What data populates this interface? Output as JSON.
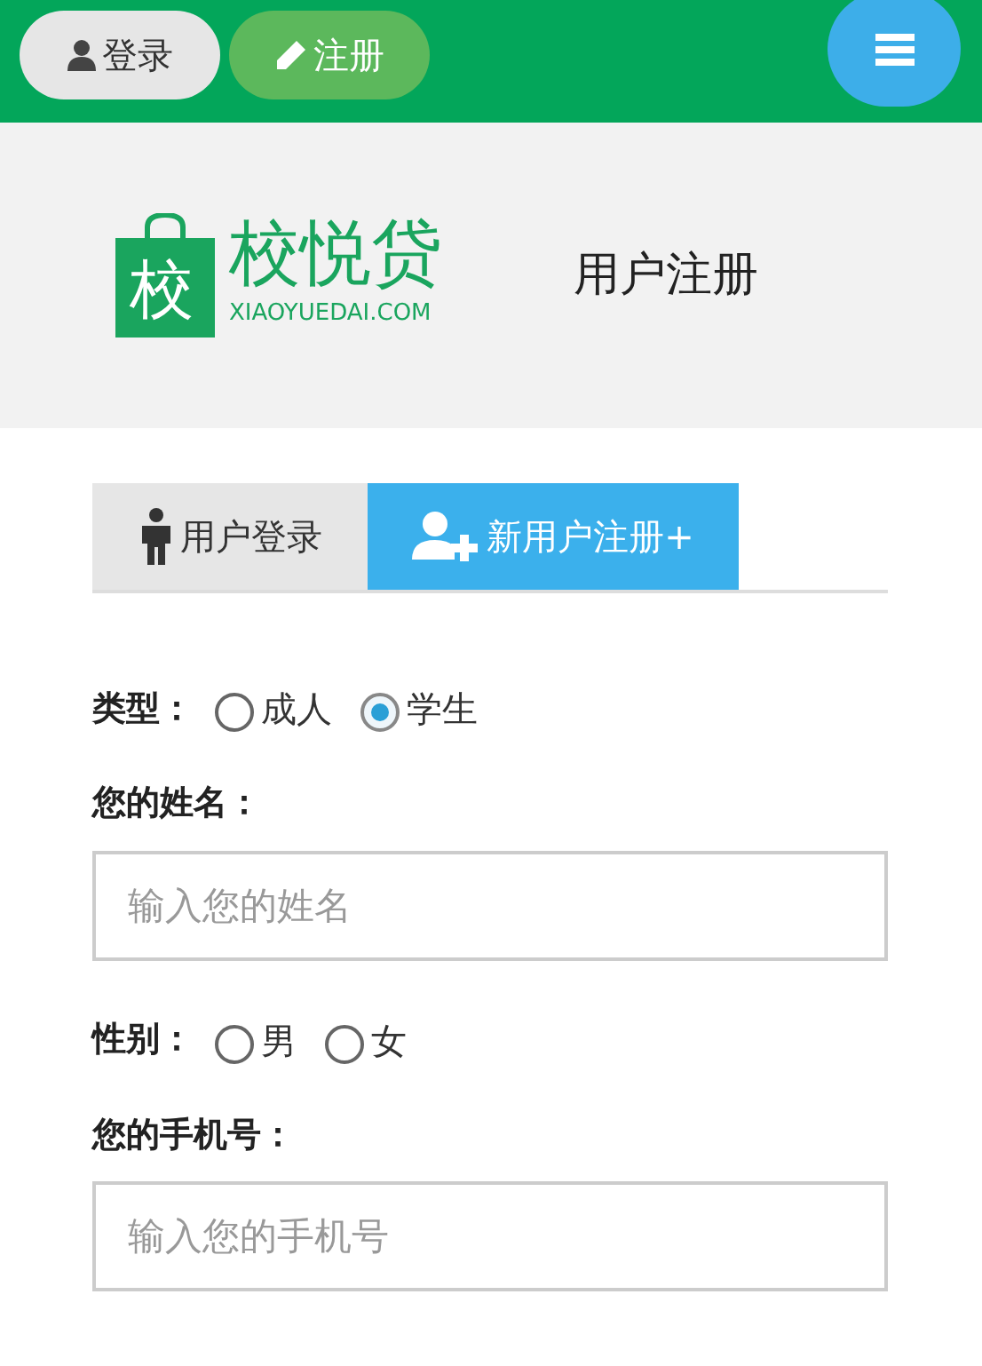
{
  "top_bar": {
    "buttons": [
      {
        "label": "登录",
        "kind": "login"
      },
      {
        "label": "注册",
        "kind": "register"
      }
    ]
  },
  "header": {
    "logo": {
      "mark": "校",
      "name": "校悦贷",
      "domain": "XIAOYUEDAI.COM"
    },
    "title": "用户注册"
  },
  "tabs": [
    {
      "label": "用户登录",
      "kind": "login",
      "selected": false
    },
    {
      "label": "新用户注册+",
      "kind": "register",
      "selected": true
    }
  ],
  "form": [
    {
      "kind": "radio",
      "label": "类型：",
      "options": [
        {
          "label": "成人",
          "selected": false
        },
        {
          "label": "学生",
          "selected": true
        }
      ]
    },
    {
      "kind": "text",
      "label": "您的姓名：",
      "placeholder": "输入您的姓名"
    },
    {
      "kind": "radio",
      "label": "性别：",
      "options": [
        {
          "label": "男",
          "selected": false
        },
        {
          "label": "女",
          "selected": false
        }
      ]
    },
    {
      "kind": "text",
      "label": "您的手机号：",
      "placeholder": "输入您的手机号"
    }
  ]
}
